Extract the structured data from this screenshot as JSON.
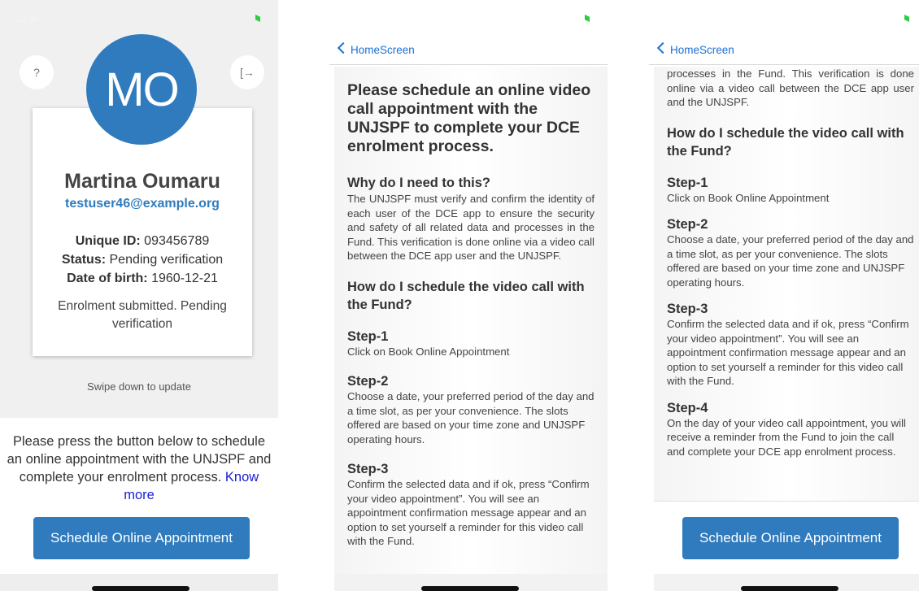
{
  "phone1": {
    "status_time": "19:36 ◁",
    "status_signal": "•ıl ≈",
    "help_label": "?",
    "logout_label": "[→",
    "avatar_initials": "MO",
    "name": "Martina Oumaru",
    "email": "testuser46@example.org",
    "unique_id_label": "Unique ID:",
    "unique_id": " 093456789",
    "status_label": "Status:",
    "status": " Pending verification",
    "dob_label": "Date of birth:",
    "dob": " 1960-12-21",
    "enrolment_status": "Enrolment submitted. Pending verification",
    "swipe_hint": "Swipe down to update",
    "instruction": "Please press the button below to schedule an online appointment with the UNJSPF and complete your enrolment process. ",
    "know_more": "Know more",
    "schedule_button": "Schedule Online Appointment"
  },
  "phone2": {
    "back_label": "HomeScreen",
    "heading": "Please schedule an online video call appointment with the UNJSPF to complete your DCE enrolment process.",
    "why_title": "Why do I need to this?",
    "why_text": "The UNJSPF must verify and confirm the identity of each user of the DCE app to ensure the security and safety of all related data and processes in the Fund. This verification is done online via a video call between the DCE app user and the UNJSPF.",
    "how_title": "How do I schedule the video call with the Fund?",
    "step1_title": "Step-1",
    "step1_text": "Click on Book Online Appointment",
    "step2_title": "Step-2",
    "step2_text": "Choose a date, your preferred period of the day and a time slot, as per your convenience. The slots offered are based on your time zone and UNJSPF operating hours.",
    "step3_title": "Step-3",
    "step3_text": "Confirm the selected data and if ok, press “Confirm your video appointment”. You will see an appointment confirmation message appear and an option to set yourself a reminder for this video call with the Fund."
  },
  "phone3": {
    "back_label": "HomeScreen",
    "intro_text": "processes in the Fund. This verification is done online via a video call between the DCE app user and the UNJSPF.",
    "how_title": "How do I schedule the video call with the Fund?",
    "step1_title": "Step-1",
    "step1_text": "Click on Book Online Appointment",
    "step2_title": "Step-2",
    "step2_text": "Choose a date, your preferred period of the day and a time slot, as per your convenience. The slots offered are based on your time zone and UNJSPF operating hours.",
    "step3_title": "Step-3",
    "step3_text": "Confirm the selected data and if ok, press “Confirm your video appointment”. You will see an appointment confirmation message appear and an option to set yourself a reminder for this video call with the Fund.",
    "step4_title": "Step-4",
    "step4_text": "On the day of your video call appointment, you will receive a reminder from the Fund to join the call and complete your DCE app enrolment process.",
    "schedule_button": "Schedule Online Appointment"
  },
  "colors": {
    "brand_blue": "#2f7bbd",
    "link_blue": "#1d6fd6",
    "know_more_blue": "#1a22d6",
    "battery_green": "#2ecc40"
  },
  "icons": {
    "help": "question-icon",
    "logout": "logout-icon",
    "back": "chevron-left-icon",
    "battery": "battery-icon"
  }
}
